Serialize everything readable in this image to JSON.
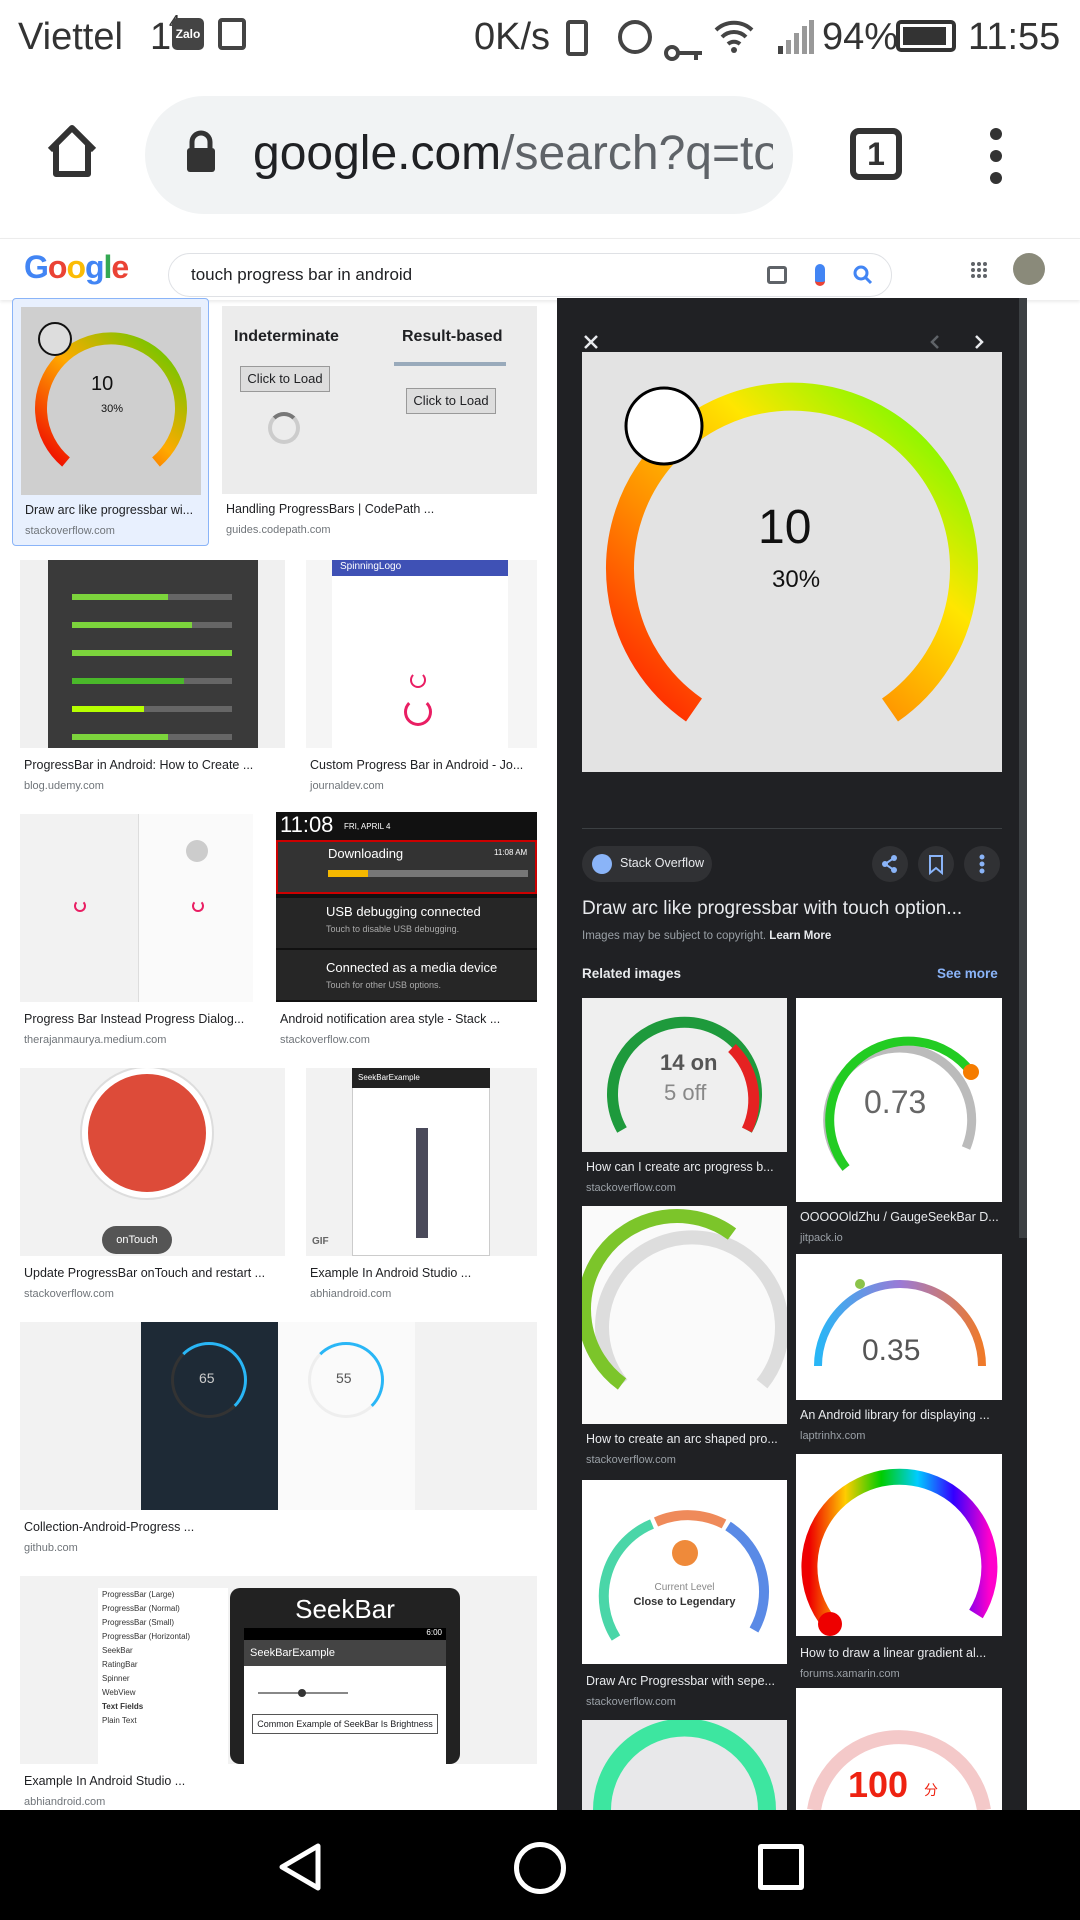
{
  "status": {
    "carrier": "Viettel",
    "signal_sup": "1",
    "signal_num": "4",
    "zalo": "Zalo",
    "speed": "0K/s",
    "battery": "94%",
    "time": "11:55"
  },
  "chrome": {
    "url_host": "google.com",
    "url_path": "/search?q=touch",
    "tab_count": "1"
  },
  "google": {
    "query": "touch progress bar in android"
  },
  "results": [
    {
      "caption": "Draw arc like progressbar wi...",
      "source": "stackoverflow.com"
    },
    {
      "caption": "Handling ProgressBars | CodePath ...",
      "source": "guides.codepath.com"
    },
    {
      "caption": "ProgressBar in Android: How to Create ...",
      "source": "blog.udemy.com"
    },
    {
      "caption": "Custom Progress Bar in Android - Jo...",
      "source": "journaldev.com"
    },
    {
      "caption": "Progress Bar Instead Progress Dialog...",
      "source": "therajanmaurya.medium.com"
    },
    {
      "caption": "Android notification area style - Stack ...",
      "source": "stackoverflow.com"
    },
    {
      "caption": "Update ProgressBar onTouch and restart ...",
      "source": "stackoverflow.com"
    },
    {
      "caption": "Example In Android Studio ...",
      "source": "abhiandroid.com"
    },
    {
      "caption": "Collection-Android-Progress ...",
      "source": "github.com"
    },
    {
      "caption": "Example In Android Studio ...",
      "source": "abhiandroid.com"
    }
  ],
  "thumbs": {
    "arc_value": "10",
    "arc_percent": "30%",
    "indeterminate": "Indeterminate",
    "result_based": "Result-based",
    "click_to_load": "Click to Load",
    "click_to_load2": "Click to Load",
    "spinning_logo": "SpinningLogo",
    "notif_time": "11:08",
    "notif_date": "FRI, APRIL 4",
    "downloading": "Downloading",
    "downloading_time": "11:08 AM",
    "usb_title": "USB debugging connected",
    "usb_sub": "Touch to disable USB debugging.",
    "media_title": "Connected as a media device",
    "media_sub": "Touch for other USB options.",
    "ontouch": "onTouch",
    "seekbar_example": "SeekBarExample",
    "gif": "GIF",
    "collection_a": "65",
    "collection_b": "55",
    "seekbar_title": "SeekBar",
    "seekbar_example2": "SeekBarExample",
    "seekbar_common": "Common Example of SeekBar Is Brightness",
    "seekbar_clock": "6:00",
    "seekbar_list": [
      "ProgressBar (Large)",
      "ProgressBar (Normal)",
      "ProgressBar (Small)",
      "ProgressBar (Horizontal)",
      "SeekBar",
      "RatingBar",
      "Spinner",
      "WebView",
      "Text Fields",
      "Plain Text"
    ]
  },
  "panel": {
    "preview_value": "10",
    "preview_percent": "30%",
    "source_name": "Stack Overflow",
    "title": "Draw arc like progressbar with touch option...",
    "copyright": "Images may be subject to copyright.",
    "learn_more": "Learn More",
    "related": "Related images",
    "see_more": "See more",
    "related_items": [
      {
        "caption": "How can I create arc progress b...",
        "source": "stackoverflow.com"
      },
      {
        "caption": "OOOOOldZhu / GaugeSeekBar D...",
        "source": "jitpack.io"
      },
      {
        "caption": "How to create an arc shaped pro...",
        "source": "stackoverflow.com"
      },
      {
        "caption": "An Android library for displaying ...",
        "source": "laptrinhx.com"
      },
      {
        "caption": "Draw Arc Progressbar with sepe...",
        "source": "stackoverflow.com"
      },
      {
        "caption": "How to draw a linear gradient al...",
        "source": "forums.xamarin.com"
      }
    ],
    "rel_14on": "14 on",
    "rel_5off": "5 off",
    "rel_073": "0.73",
    "rel_035": "0.35",
    "rel_level": "Current Level",
    "rel_legendary": "Close to Legendary",
    "rel_100": "100",
    "rel_100_unit": "分"
  }
}
